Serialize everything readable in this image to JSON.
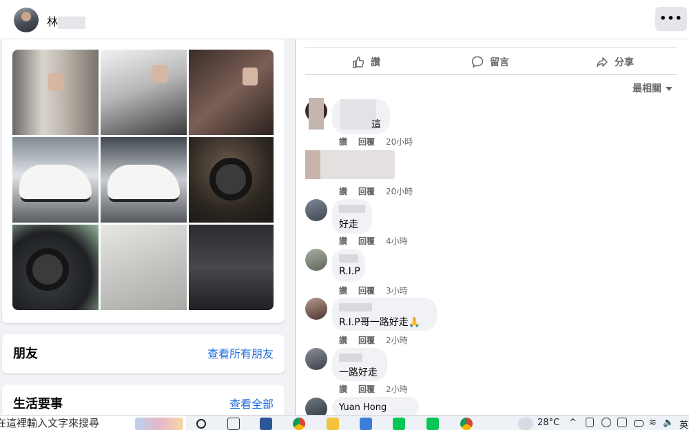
{
  "header": {
    "user_name": "林",
    "more_label": "•••"
  },
  "actions": {
    "like": "讚",
    "comment": "留言",
    "share": "分享"
  },
  "sort": {
    "label": "最相關"
  },
  "friends": {
    "title": "朋友",
    "link": "查看所有朋友"
  },
  "life_events": {
    "title": "生活要事",
    "link": "查看全部"
  },
  "comments": [
    {
      "name": "",
      "text": "這",
      "like": "讚",
      "reply": "回覆",
      "time": "20小時"
    },
    {
      "name": "",
      "text": "",
      "like": "讚",
      "reply": "回覆",
      "time": "20小時"
    },
    {
      "name": "",
      "text": "好走",
      "like": "讚",
      "reply": "回覆",
      "time": "4小時"
    },
    {
      "name": "",
      "text": "R.I.P",
      "like": "讚",
      "reply": "回覆",
      "time": "3小時"
    },
    {
      "name": "",
      "text": "R.I.P哥一路好走🙏",
      "like": "讚",
      "reply": "回覆",
      "time": "2小時"
    },
    {
      "name": "",
      "text": "一路好走",
      "like": "讚",
      "reply": "回覆",
      "time": "2小時"
    },
    {
      "name": "Yuan Hong",
      "text": ""
    }
  ],
  "taskbar": {
    "search_placeholder": "在這裡輸入文字來搜尋",
    "temperature": "28°C",
    "lang": "英"
  },
  "colors": {
    "link": "#216fdb",
    "secondary_text": "#65676b",
    "bubble": "#f0f2f5"
  }
}
